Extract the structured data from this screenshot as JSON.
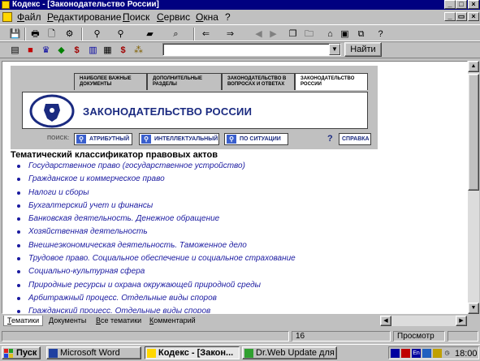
{
  "window": {
    "title": "Кодекс - [Законодательство России]"
  },
  "menubar": {
    "items": [
      "Файл",
      "Редактирование",
      "Поиск",
      "Сервис",
      "Окна",
      "?"
    ]
  },
  "search_bar": {
    "query_value": "",
    "find_label": "Найти"
  },
  "banner": {
    "tabs": [
      "НАИБОЛЕЕ ВАЖНЫЕ ДОКУМЕНТЫ",
      "ДОПОЛНИТЕЛЬНЫЕ РАЗДЕЛЫ",
      "ЗАКОНОДАТЕЛЬСТВО В ВОПРОСАХ И ОТВЕТАХ",
      "ЗАКОНОДАТЕЛЬСТВО РОССИИ"
    ],
    "title": "ЗАКОНОДАТЕЛЬСТВО РОССИИ",
    "search_label": "ПОИСК:",
    "search_buttons": [
      "АТРИБУТНЫЙ",
      "ИНТЕЛЛЕКТУАЛЬНЫЙ",
      "ПО СИТУАЦИИ"
    ],
    "help_label": "СПРАВКА"
  },
  "content": {
    "heading": "Тематический классификатор правовых актов",
    "topics": [
      "Государственное право (государственное устройство)",
      "Гражданское и коммерческое право",
      "Налоги и сборы",
      "Бухгалтерский учет и финансы",
      "Банковская деятельность. Денежное обращение",
      "Хозяйственная деятельность",
      "Внешнеэкономическая деятельность. Таможенное дело",
      "Трудовое право. Социальное обеспечение и социальное страхование",
      "Социально-культурная сфера",
      "Природные ресурсы и охрана окружающей природной среды",
      "Арбитражный процесс. Отдельные виды споров",
      "Гражданский процесс. Отдельные виды споров"
    ]
  },
  "doc_tabs": [
    "Тематики",
    "Документы",
    "Все тематики",
    "Комментарий"
  ],
  "statusbar": {
    "page": "16",
    "mode": "Просмотр"
  },
  "taskbar": {
    "start_label": "Пуск",
    "tasks": [
      "Microsoft Word",
      "Кодекс - [Закон...",
      "Dr.Web Update для ..."
    ],
    "tray_lang": "En",
    "clock": "18:00"
  },
  "colors": {
    "titlebar": "#000080",
    "link": "#1a1aa0",
    "banner_title": "#1a2a80"
  }
}
